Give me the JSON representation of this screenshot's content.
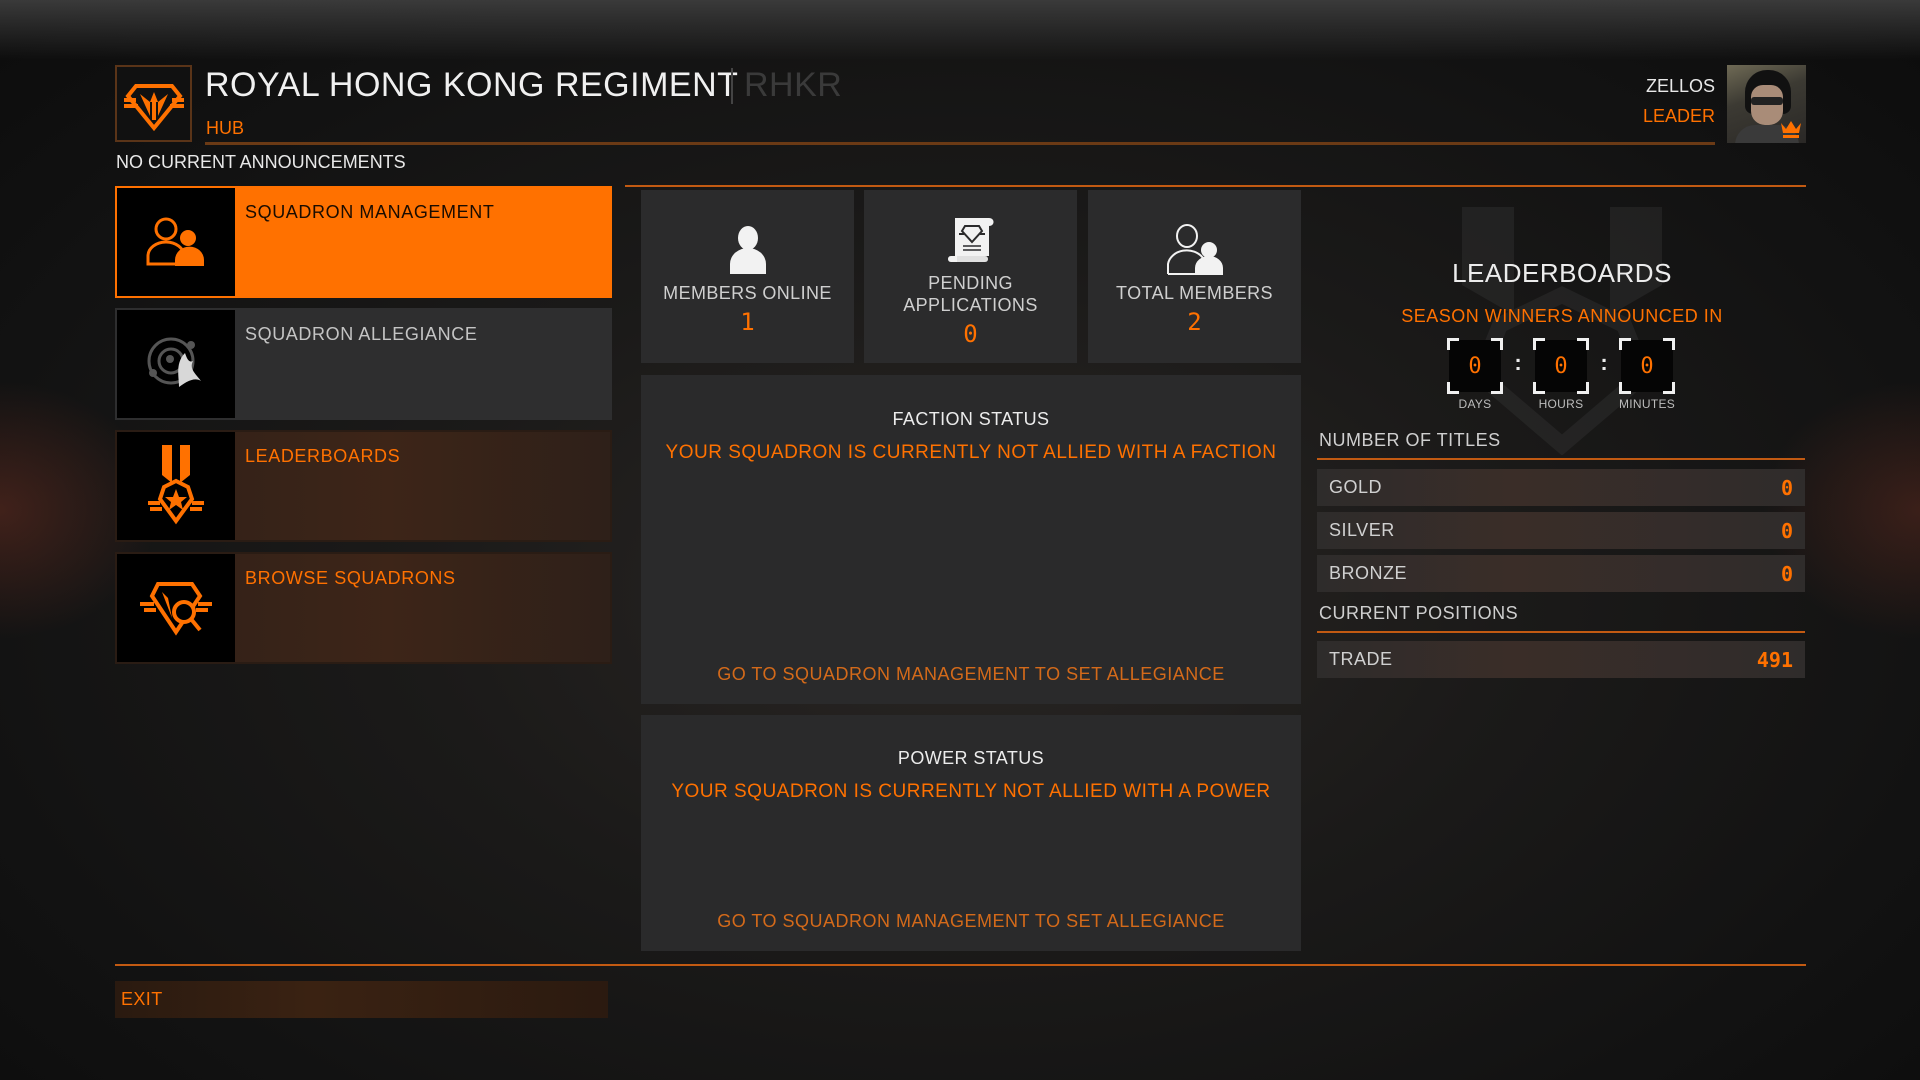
{
  "header": {
    "squadron_name": "ROYAL HONG KONG REGIMENT",
    "squadron_tag": "RHKR",
    "section": "HUB",
    "announcement": "NO CURRENT ANNOUNCEMENTS",
    "logo_icon": "squadron-emblem-icon"
  },
  "user": {
    "name": "ZELLOS",
    "role": "LEADER",
    "avatar_badge_icon": "crown-icon"
  },
  "sidebar": {
    "items": [
      {
        "label": "SQUADRON MANAGEMENT",
        "icon": "members-icon",
        "state": "active"
      },
      {
        "label": "SQUADRON ALLEGIANCE",
        "icon": "allegiance-icon",
        "state": "neutral"
      },
      {
        "label": "LEADERBOARDS",
        "icon": "medal-icon",
        "state": "highlight"
      },
      {
        "label": "BROWSE SQUADRONS",
        "icon": "browse-squadrons-icon",
        "state": "highlight"
      }
    ]
  },
  "stats": [
    {
      "label": "MEMBERS ONLINE",
      "value": "1",
      "icon": "person-icon"
    },
    {
      "label": "PENDING APPLICATIONS",
      "value": "0",
      "icon": "application-scroll-icon"
    },
    {
      "label": "TOTAL MEMBERS",
      "value": "2",
      "icon": "group-icon"
    }
  ],
  "faction_status": {
    "title": "FACTION STATUS",
    "message": "YOUR SQUADRON IS CURRENTLY NOT ALLIED WITH A FACTION",
    "link": "GO TO SQUADRON MANAGEMENT TO SET ALLEGIANCE"
  },
  "power_status": {
    "title": "POWER STATUS",
    "message": "YOUR SQUADRON IS CURRENTLY NOT ALLIED WITH A POWER",
    "link": "GO TO SQUADRON MANAGEMENT TO SET ALLEGIANCE"
  },
  "leaderboards": {
    "title": "LEADERBOARDS",
    "subtitle": "SEASON WINNERS ANNOUNCED IN",
    "countdown": {
      "days": "0",
      "hours": "0",
      "minutes": "0",
      "days_label": "DAYS",
      "hours_label": "HOURS",
      "minutes_label": "MINUTES",
      "separator": ":"
    },
    "titles_heading": "NUMBER OF TITLES",
    "titles": [
      {
        "label": "GOLD",
        "value": "0"
      },
      {
        "label": "SILVER",
        "value": "0"
      },
      {
        "label": "BRONZE",
        "value": "0"
      }
    ],
    "positions_heading": "CURRENT POSITIONS",
    "positions": [
      {
        "label": "TRADE",
        "value": "491"
      }
    ]
  },
  "footer": {
    "exit_label": "EXIT"
  },
  "colors": {
    "accent": "#ff7100",
    "panel": "#2a2a2b",
    "text": "#d8d8d8"
  }
}
